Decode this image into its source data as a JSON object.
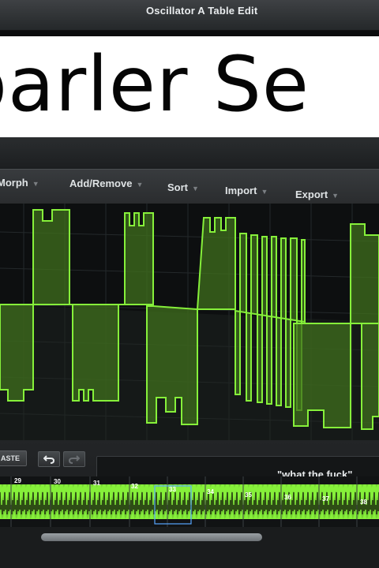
{
  "window": {
    "title": "Oscillator A Table Edit"
  },
  "banner": {
    "text": "parler Se"
  },
  "menu": [
    {
      "label": "Morph"
    },
    {
      "label": "Add/Remove"
    },
    {
      "label": "Sort"
    },
    {
      "label": "Import"
    },
    {
      "label": "Export"
    }
  ],
  "toolbar": {
    "paste_label": "ASTE",
    "undo_icon": "undo-icon",
    "redo_icon": "redo-icon"
  },
  "name_field": {
    "value": "\"what the fuck\""
  },
  "frames": {
    "labels": [
      "29",
      "30",
      "31",
      "32",
      "33",
      "34",
      "35",
      "36",
      "37",
      "38"
    ],
    "selected": "33"
  },
  "colors": {
    "wave": "#7ee832",
    "wave_fill": "#3c6b1a",
    "background": "#0d0f10"
  }
}
